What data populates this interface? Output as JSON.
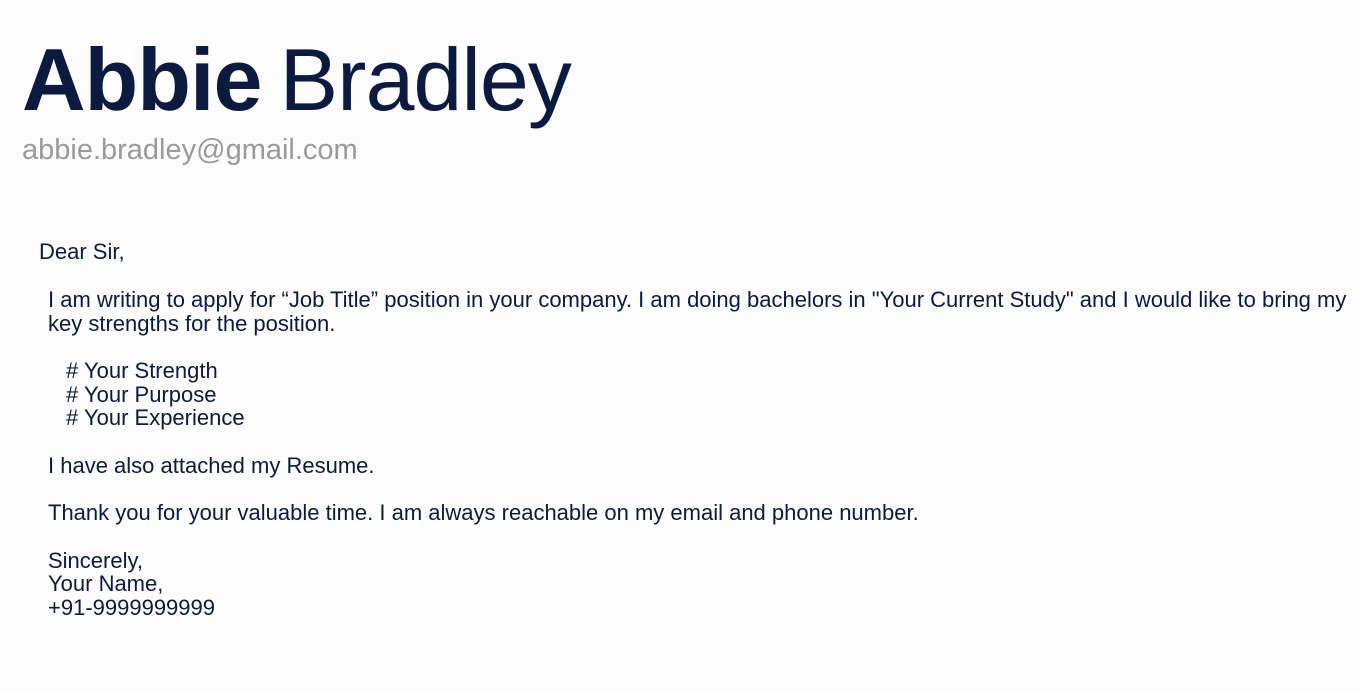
{
  "header": {
    "first_name": "Abbie",
    "last_name": "Bradley",
    "email": "abbie.bradley@gmail.com"
  },
  "letter": {
    "salutation": "Dear Sir,",
    "intro": "I am writing to apply for “Job Title” position in your company.  I am doing bachelors in \"Your Current Study\" and  I would like to bring my key strengths for the position.",
    "points": [
      "# Your Strength",
      "# Your Purpose",
      "# Your Experience"
    ],
    "attachment_line": "I have also attached my Resume.",
    "thanks_line": "Thank you for your valuable time. I am always reachable on my email and phone number.",
    "closing": "Sincerely,",
    "signature_name": "Your Name,",
    "phone": "+91-9999999999"
  }
}
